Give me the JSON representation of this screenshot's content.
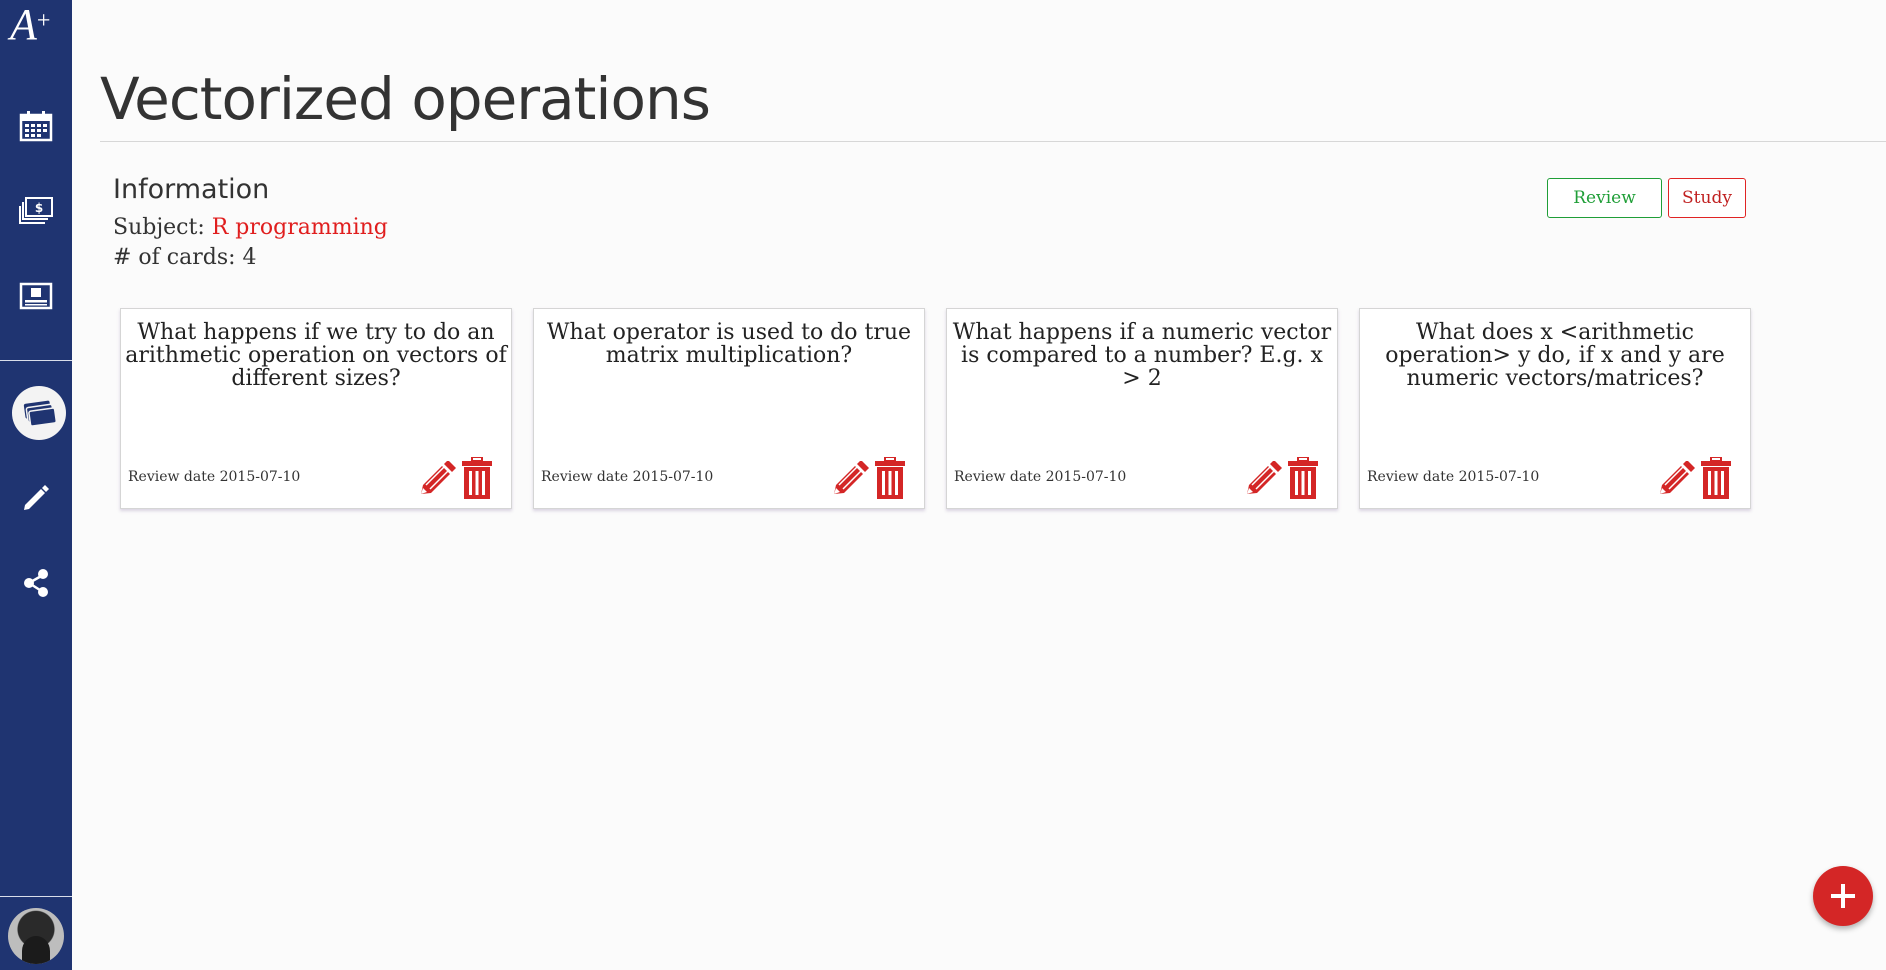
{
  "app": {
    "logo_text": "A",
    "logo_superscript": "+"
  },
  "sidebar": {
    "items": [
      {
        "name": "calendar",
        "icon": "calendar-icon"
      },
      {
        "name": "money",
        "icon": "money-stack-icon"
      },
      {
        "name": "ticket",
        "icon": "ticket-icon"
      },
      {
        "name": "decks",
        "icon": "cards-stack-icon",
        "active": true
      },
      {
        "name": "edit",
        "icon": "pencil-icon"
      },
      {
        "name": "share",
        "icon": "share-icon"
      }
    ],
    "avatar_icon": "user-avatar"
  },
  "page": {
    "title": "Vectorized operations"
  },
  "info": {
    "heading": "Information",
    "subject_label": "Subject: ",
    "subject_value": "R programming",
    "cards_label": "# of cards: ",
    "cards_value": "4"
  },
  "actions": {
    "review_label": "Review",
    "study_label": "Study"
  },
  "cards": [
    {
      "question": "What happens if we try to do an arithmetic operation on vectors of different sizes?",
      "review_date": "Review date 2015-07-10"
    },
    {
      "question": "What operator is used to do true matrix multiplication?",
      "review_date": "Review date 2015-07-10"
    },
    {
      "question": "What happens if a numeric vector is compared to a number? E.g. x > 2",
      "review_date": "Review date 2015-07-10"
    },
    {
      "question": "What does x <arithmetic operation> y do, if x and y are numeric vectors/matrices?",
      "review_date": "Review date 2015-07-10"
    }
  ],
  "colors": {
    "sidebar": "#1f3471",
    "accent_red": "#e01e1e",
    "review_green": "#1f9e37",
    "icon_red": "#d42626"
  },
  "fab": {
    "icon": "plus-icon"
  }
}
